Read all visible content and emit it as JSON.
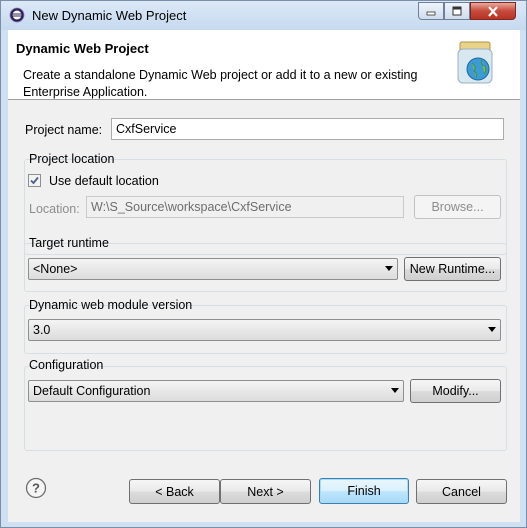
{
  "window": {
    "title": "New Dynamic Web Project",
    "icon": "eclipse-icon"
  },
  "header": {
    "title": "Dynamic Web Project",
    "description": "Create a standalone Dynamic Web project or add it to a new or existing Enterprise Application.",
    "icon": "web-project-wizard-icon"
  },
  "project_name": {
    "label": "Project name:",
    "value": "CxfService"
  },
  "project_location": {
    "group_title": "Project location",
    "use_default_label": "Use default location",
    "use_default_checked": true,
    "location_label": "Location:",
    "location_value": "W:\\S_Source\\workspace\\CxfService",
    "browse_label": "Browse..."
  },
  "target_runtime": {
    "group_title": "Target runtime",
    "selected": "<None>",
    "new_runtime_label": "New Runtime..."
  },
  "module_version": {
    "group_title": "Dynamic web module version",
    "selected": "3.0"
  },
  "configuration": {
    "group_title": "Configuration",
    "selected": "Default Configuration",
    "modify_label": "Modify..."
  },
  "footer": {
    "back_label": "< Back",
    "next_label": "Next >",
    "finish_label": "Finish",
    "cancel_label": "Cancel",
    "help_icon": "help-icon"
  },
  "colors": {
    "title_bar": "#c6d9ef",
    "dialog_bg": "#f0f0f0",
    "close_button": "#c7493a",
    "default_button_border": "#3c7fb1"
  }
}
